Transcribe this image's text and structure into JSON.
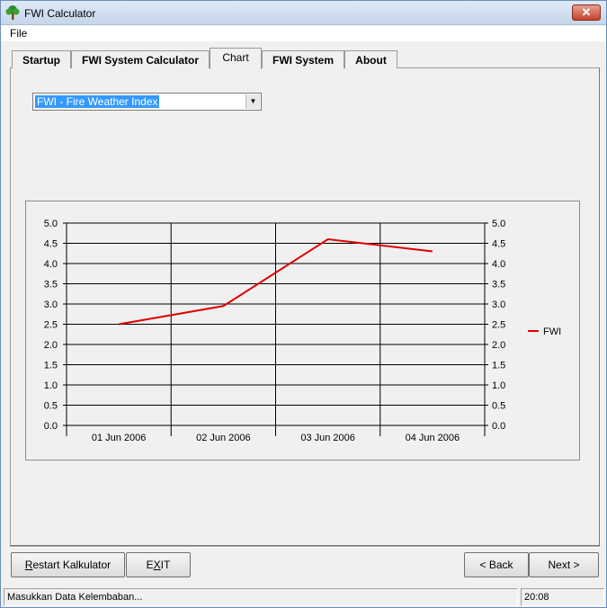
{
  "window": {
    "title": "FWI Calculator",
    "close_glyph": "✕",
    "icon": "tree-icon"
  },
  "menu": {
    "file": "File"
  },
  "tabs": [
    {
      "label": "Startup"
    },
    {
      "label": "FWI System Calculator"
    },
    {
      "label": "Chart",
      "active": true
    },
    {
      "label": "FWI System"
    },
    {
      "label": "About"
    }
  ],
  "index_select": {
    "value": "FWI - Fire Weather Index"
  },
  "chart_data": {
    "type": "line",
    "categories": [
      "01 Jun 2006",
      "02 Jun 2006",
      "03 Jun 2006",
      "04 Jun 2006"
    ],
    "series": [
      {
        "name": "FWI",
        "color": "#e00000",
        "values": [
          2.5,
          2.95,
          4.6,
          4.3
        ]
      }
    ],
    "ylim": [
      0,
      5
    ],
    "yticks": [
      "0.0",
      "0.5",
      "1.0",
      "1.5",
      "2.0",
      "2.5",
      "3.0",
      "3.5",
      "4.0",
      "4.5",
      "5.0"
    ],
    "grid": true,
    "dual_y_axis": true,
    "legend": "right"
  },
  "buttons": {
    "restart_first": "R",
    "restart_rest": "estart Kalkulator",
    "exit_a": "E",
    "exit_u": "X",
    "exit_b": "IT",
    "back": "< Back",
    "next": "Next >"
  },
  "status": {
    "message": "Masukkan Data Kelembaban...",
    "time": "20:08"
  }
}
